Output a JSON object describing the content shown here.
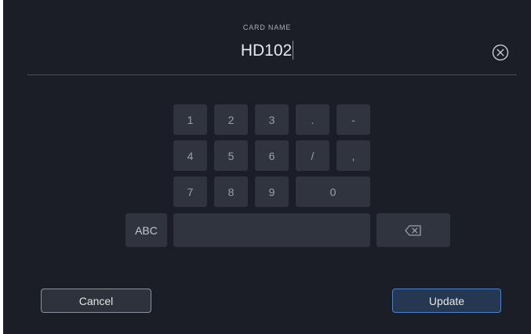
{
  "field": {
    "label": "CARD NAME",
    "value": "HD102"
  },
  "keypad": {
    "row1": [
      "1",
      "2",
      "3",
      ".",
      "-"
    ],
    "row2": [
      "4",
      "5",
      "6",
      "/",
      ","
    ],
    "row3": [
      "7",
      "8",
      "9",
      "0"
    ],
    "abc_label": "ABC",
    "space_label": "",
    "backspace_icon": "backspace-icon"
  },
  "actions": {
    "cancel_label": "Cancel",
    "update_label": "Update"
  },
  "icons": {
    "clear": "close-circle-icon"
  },
  "colors": {
    "background": "#1b1e26",
    "key": "#2f343e",
    "caret": "#4aa3ff",
    "update_border": "#4f82c4"
  }
}
